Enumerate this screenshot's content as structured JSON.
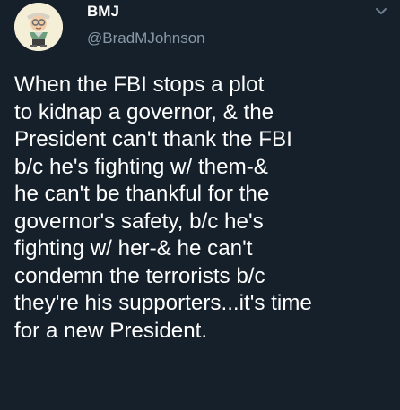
{
  "author": {
    "display_name": "BMJ",
    "handle": "@BradMJohnson"
  },
  "tweet": {
    "lines": [
      "When the FBI stops a plot",
      "to kidnap a governor, & the",
      "President can't thank the FBI",
      "b/c he's fighting w/ them-&",
      "he can't be thankful for the",
      "governor's safety, b/c he's",
      "fighting w/ her-& he can't",
      "condemn the terrorists b/c",
      "they're his supporters...it's time",
      "for a new President."
    ]
  },
  "icons": {
    "avatar": "cartoon-portrait-avatar",
    "menu": "chevron-down-icon"
  },
  "colors": {
    "background": "#15202b",
    "text_primary": "#ffffff",
    "text_secondary": "#8899a6"
  }
}
